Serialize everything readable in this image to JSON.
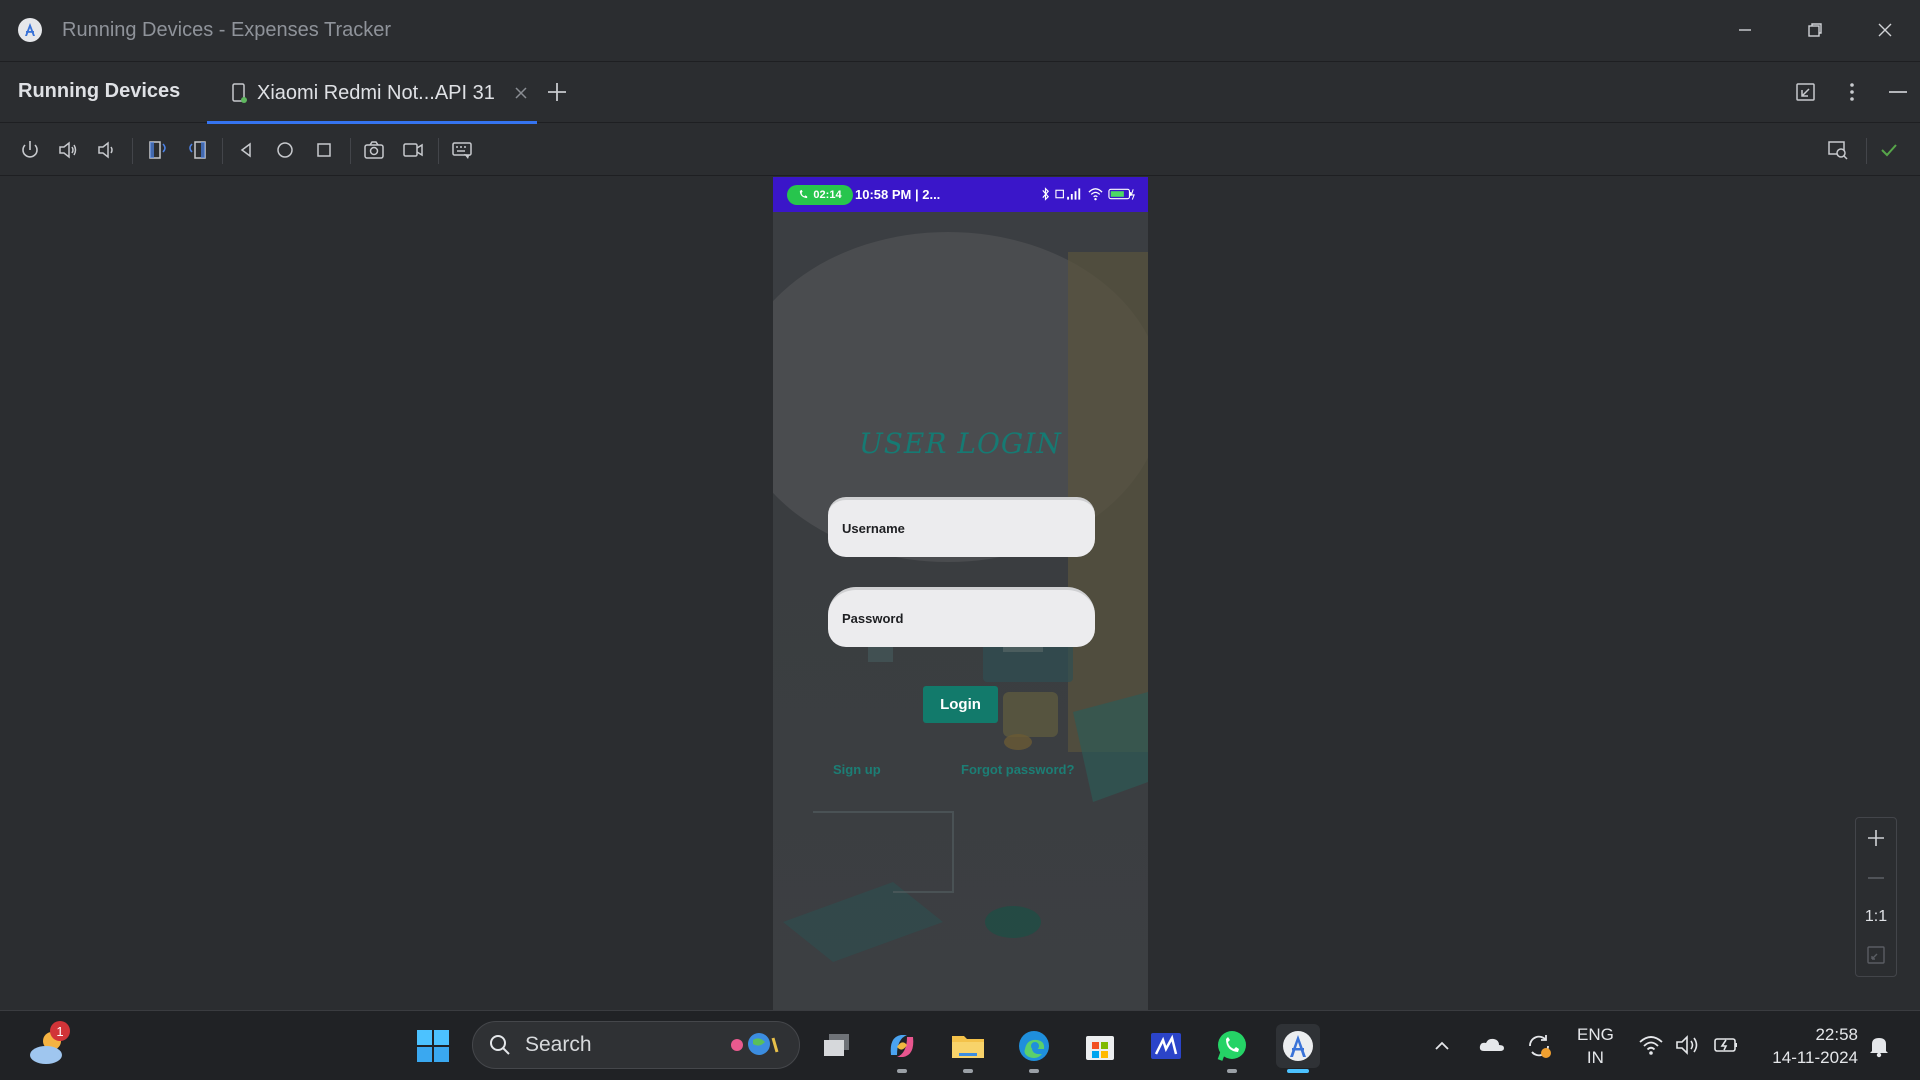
{
  "window": {
    "title": "Running Devices - Expenses Tracker",
    "controls": [
      "minimize-icon",
      "restore-icon",
      "close-icon"
    ]
  },
  "tool_window": {
    "title": "Running Devices",
    "tabs": [
      {
        "label": "Xiaomi Redmi Not...API 31",
        "icon": "phone-icon",
        "active": true
      }
    ]
  },
  "toolbar": {
    "buttons": [
      "power-icon",
      "volume-up-icon",
      "volume-down-icon",
      "rotate-left-icon",
      "rotate-right-icon",
      "back-icon",
      "home-icon",
      "overview-icon",
      "screenshot-icon",
      "screen-record-icon",
      "keyboard-icon"
    ],
    "right_buttons": [
      "device-mirroring-icon",
      "check-icon"
    ]
  },
  "phone": {
    "status_bar": {
      "call_timer": "02:14",
      "time": "10:58 PM | 2...",
      "battery": "77",
      "background_color": "#3a16c9"
    },
    "login": {
      "title": "USER LOGIN",
      "username_placeholder": "Username",
      "password_placeholder": "Password",
      "button_label": "Login",
      "signup_label": "Sign up",
      "forgot_label": "Forgot password?",
      "accent_color": "#127a6b"
    }
  },
  "zoom": {
    "reset_label": "1:1"
  },
  "taskbar": {
    "weather_badge": "1",
    "search_label": "Search",
    "apps": [
      "windows-start-icon",
      "task-view-icon",
      "copilot-icon",
      "file-explorer-icon",
      "edge-icon",
      "microsoft-store-icon",
      "pen-app-icon",
      "whatsapp-icon",
      "android-studio-icon"
    ],
    "language": {
      "line1": "ENG",
      "line2": "IN"
    },
    "clock": {
      "time": "22:58",
      "date": "14-11-2024"
    }
  }
}
